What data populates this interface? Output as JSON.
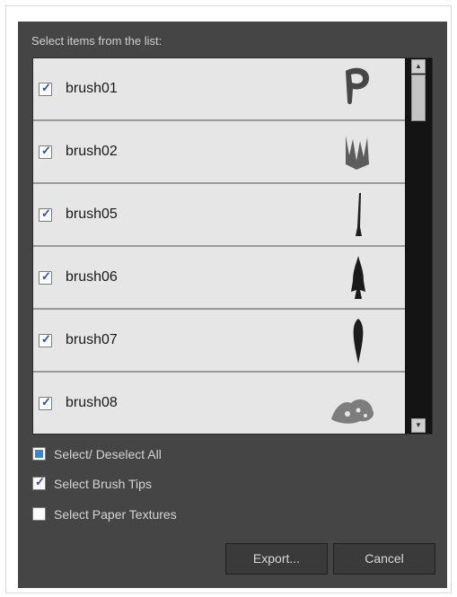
{
  "dialog": {
    "prompt": "Select items from the list:",
    "items": [
      {
        "label": "brush01",
        "checked": true,
        "tip_icon": "brush-tip-p-icon"
      },
      {
        "label": "brush02",
        "checked": true,
        "tip_icon": "brush-tip-splatter-icon"
      },
      {
        "label": "brush05",
        "checked": true,
        "tip_icon": "brush-tip-thin-icon"
      },
      {
        "label": "brush06",
        "checked": true,
        "tip_icon": "brush-tip-point-icon"
      },
      {
        "label": "brush07",
        "checked": true,
        "tip_icon": "brush-tip-stroke-icon"
      },
      {
        "label": "brush08",
        "checked": true,
        "tip_icon": "brush-tip-sponge-icon"
      }
    ],
    "options": {
      "select_all": {
        "label": "Select/ Deselect All",
        "state": "partial"
      },
      "brush_tips": {
        "label": "Select Brush Tips",
        "checked": true
      },
      "paper_textures": {
        "label": "Select Paper Textures",
        "checked": false
      }
    },
    "buttons": {
      "export": "Export...",
      "cancel": "Cancel"
    }
  },
  "colors": {
    "dialog_bg": "#454545",
    "row_bg": "#e6e6e6",
    "check_accent": "#2b4ea8",
    "partial_accent": "#3b86c6"
  }
}
